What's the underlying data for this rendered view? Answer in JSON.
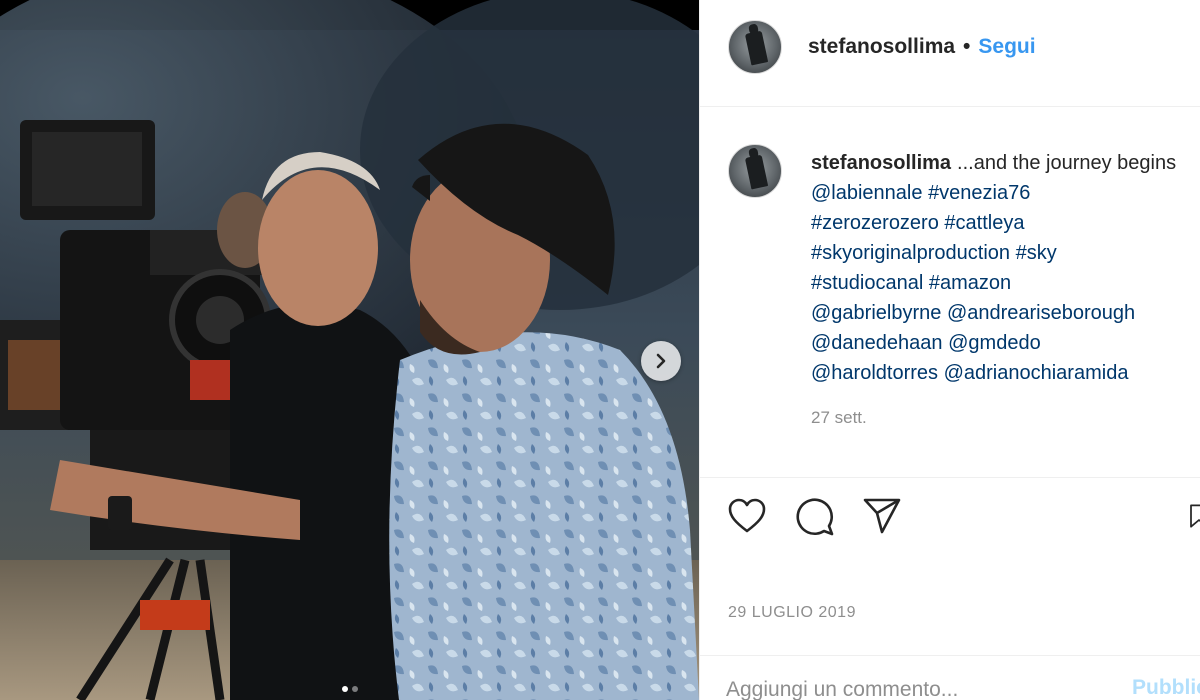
{
  "post": {
    "author": "stefanosollima",
    "separator": "•",
    "follow_label": "Segui",
    "caption": {
      "username": "stefanosollima",
      "text_start": "...and the journey begins",
      "line1_tags": [
        "@labiennale",
        "#venezia76"
      ],
      "line2_tags": [
        "#zerozerozero",
        "#cattleya"
      ],
      "line3_tags": [
        "#skyoriginalproduction",
        "#sky"
      ],
      "line4_tags": [
        "#studiocanal",
        "#amazon"
      ],
      "line5_tags": [
        "@gabrielbyrne",
        "@andreariseborough"
      ],
      "line6_tags": [
        "@danedehaan",
        "@gmdedo"
      ],
      "line7_tags": [
        "@haroldtorres",
        "@adrianochiaramida"
      ]
    },
    "time_ago": "27 sett.",
    "date": "29 LUGLIO 2019"
  },
  "comment_box": {
    "placeholder": "Aggiungi un commento...",
    "publish_label": "Pubblica"
  },
  "carousel": {
    "slide_count": 2,
    "active_slide": 1
  },
  "icons": {
    "like": "heart-icon",
    "comment": "comment-bubble-icon",
    "share": "paper-plane-icon",
    "save": "bookmark-icon",
    "next": "chevron-right-icon"
  },
  "colors": {
    "follow": "#3897f0",
    "hashtag": "#00376b",
    "muted": "#8e8e8e",
    "publish_disabled": "#b2dffc"
  }
}
